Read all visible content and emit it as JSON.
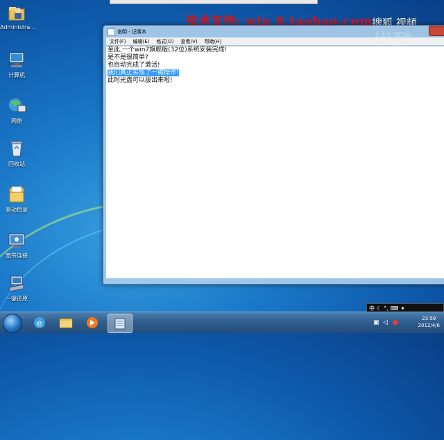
{
  "desktop": {
    "icons": [
      {
        "label": "Administra...",
        "icon": "user-folder-icon"
      },
      {
        "label": "计算机",
        "icon": "computer-icon"
      },
      {
        "label": "网络",
        "icon": "network-icon"
      },
      {
        "label": "回收站",
        "icon": "recycle-bin-icon"
      },
      {
        "label": "驱动目录",
        "icon": "folder-icon"
      },
      {
        "label": "宽带连接",
        "icon": "broadband-icon"
      },
      {
        "label": "一键还原",
        "icon": "restore-icon"
      }
    ],
    "watermark": "技术支持: win 8.taobao.com",
    "youku_small": "搜狐 视频",
    "youku_big": "优酷"
  },
  "notepad": {
    "title": "说明 - 记事本",
    "menu": [
      "文件(F)",
      "编辑(E)",
      "格式(O)",
      "查看(V)",
      "帮助(H)"
    ],
    "lines": [
      "至此,一个win7旗舰版(32位)系统安装完成!",
      "是不是很简单?",
      "也自动完成了激活!",
      "我们真正实现了一键操作!",
      "此时光盘可以拔出来啦!"
    ],
    "selected_line_index": 3
  },
  "taskbar": {
    "time": "23:59",
    "date": "2012/4/6",
    "ime_text": "中",
    "pinned": [
      "ie-icon",
      "explorer-icon",
      "media-player-icon",
      "notepad-icon"
    ]
  },
  "colors": {
    "watermark": "#e01010",
    "selection": "#3399ff",
    "close_button": "#c8463a"
  }
}
